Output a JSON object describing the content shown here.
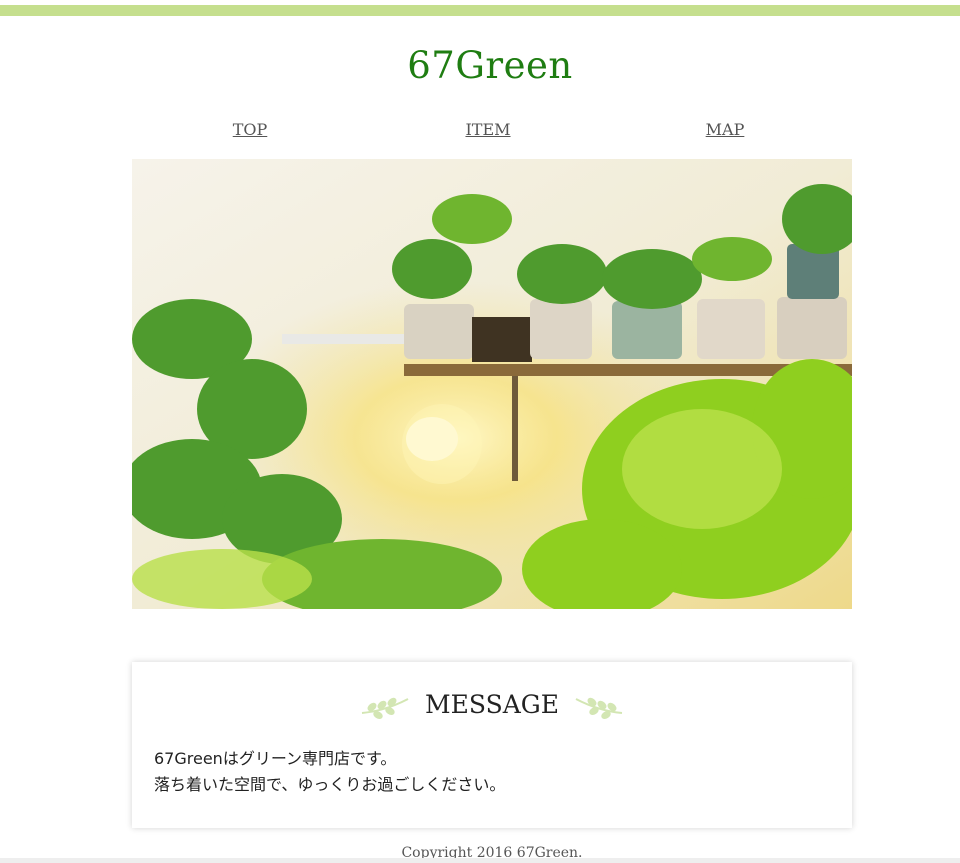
{
  "colors": {
    "accent_bar": "#c5df8e",
    "title": "#1f7d12",
    "nav_link": "#555555",
    "text": "#222222",
    "sprig": "#d3e6b3"
  },
  "header": {
    "title": "67Green"
  },
  "nav": {
    "items": [
      {
        "label": "TOP"
      },
      {
        "label": "ITEM"
      },
      {
        "label": "MAP"
      }
    ]
  },
  "hero": {
    "icon": "plants-shelf-photo"
  },
  "message": {
    "title": "MESSAGE",
    "line1": "67Greenはグリーン専門店です。",
    "line2": "落ち着いた空間で、ゆっくりお過ごしください。",
    "decoration_icon": "leaf-sprig-icon"
  },
  "footer": {
    "copyright": "Copyright 2016 67Green."
  }
}
